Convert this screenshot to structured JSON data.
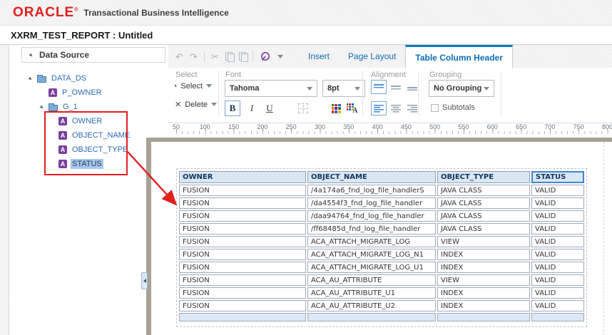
{
  "brand": {
    "logo": "ORACLE",
    "registered_mark": "®",
    "product": "Transactional Business Intelligence"
  },
  "title": "XXRM_TEST_REPORT : Untitled",
  "sidebar": {
    "header": "Data Source",
    "tree": [
      {
        "label": "DATA_DS",
        "type": "folder",
        "expanded": true,
        "pad": 8,
        "selected": false
      },
      {
        "label": "P_OWNER",
        "type": "field",
        "pad": 38,
        "selected": false
      },
      {
        "label": "G_1",
        "type": "folder",
        "expanded": true,
        "pad": 24,
        "selected": false
      },
      {
        "label": "OWNER",
        "type": "field",
        "pad": 52,
        "selected": false
      },
      {
        "label": "OBJECT_NAME",
        "type": "field",
        "pad": 52,
        "selected": false
      },
      {
        "label": "OBJECT_TYPE",
        "type": "field",
        "pad": 52,
        "selected": false
      },
      {
        "label": "STATUS",
        "type": "field",
        "pad": 52,
        "selected": true
      }
    ]
  },
  "toolbar": {
    "icons": [
      {
        "name": "undo-icon",
        "glyph": "↶"
      },
      {
        "name": "redo-icon",
        "glyph": "↷"
      },
      {
        "name": "separator",
        "glyph": ""
      },
      {
        "name": "cut-icon",
        "glyph": "✂"
      },
      {
        "name": "copy-icon",
        "glyph": ""
      },
      {
        "name": "paste-icon",
        "glyph": ""
      },
      {
        "name": "separator",
        "glyph": ""
      },
      {
        "name": "data-options-icon",
        "glyph": ""
      },
      {
        "name": "dropdown-caret-icon",
        "glyph": ""
      }
    ],
    "tabs": [
      {
        "label": "Insert",
        "active": false
      },
      {
        "label": "Page Layout",
        "active": false
      },
      {
        "label": "Table Column Header",
        "active": true
      }
    ]
  },
  "ribbon": {
    "select_group": {
      "label": "Select",
      "select_button": "Select",
      "delete_button": "Delete"
    },
    "font_group": {
      "label": "Font",
      "family": "Tahoma",
      "size": "8pt",
      "bold": "B",
      "italic": "I",
      "underline": "U"
    },
    "alignment_group": {
      "label": "Alignment"
    },
    "grouping_group": {
      "label": "Grouping",
      "value": "No Grouping",
      "subtotals_label": "Subtotals"
    }
  },
  "ruler": {
    "labels": [
      50,
      100,
      150,
      200,
      250,
      300,
      350,
      400,
      450,
      500,
      550,
      600,
      650,
      700,
      750,
      800
    ]
  },
  "report_table": {
    "columns": [
      "OWNER",
      "OBJECT_NAME",
      "OBJECT_TYPE",
      "STATUS"
    ],
    "selected_column": "STATUS",
    "rows": [
      [
        "FUSION",
        "/4a174a6_fnd_log_file_handlerS",
        "JAVA CLASS",
        "VALID"
      ],
      [
        "FUSION",
        "/da4554f3_fnd_log_file_handler",
        "JAVA CLASS",
        "VALID"
      ],
      [
        "FUSION",
        "/daa94764_fnd_log_file_handler",
        "JAVA CLASS",
        "VALID"
      ],
      [
        "FUSION",
        "/ff68485d_fnd_log_file_handler",
        "JAVA CLASS",
        "VALID"
      ],
      [
        "FUSION",
        "ACA_ATTACH_MIGRATE_LOG",
        "VIEW",
        "VALID"
      ],
      [
        "FUSION",
        "ACA_ATTACH_MIGRATE_LOG_N1",
        "INDEX",
        "VALID"
      ],
      [
        "FUSION",
        "ACA_ATTACH_MIGRATE_LOG_U1",
        "INDEX",
        "VALID"
      ],
      [
        "FUSION",
        "ACA_AU_ATTRIBUTE",
        "VIEW",
        "VALID"
      ],
      [
        "FUSION",
        "ACA_AU_ATTRIBUTE_U1",
        "INDEX",
        "VALID"
      ],
      [
        "FUSION",
        "ACA_AU_ATTRIBUTE_U2",
        "INDEX",
        "VALID"
      ]
    ]
  },
  "colors": {
    "brand_red": "#e21f1f",
    "annotation_red": "#e11f1f",
    "accent_blue": "#0c7cc2",
    "link_blue": "#2a6cb4",
    "selection_blue": "#a9c7e9",
    "table_header_bg": "#d9e6f4",
    "footer_row_bg": "#dce8f5",
    "field_icon_purple": "#7b3f9e",
    "canvas_frame": "#a8a295"
  }
}
